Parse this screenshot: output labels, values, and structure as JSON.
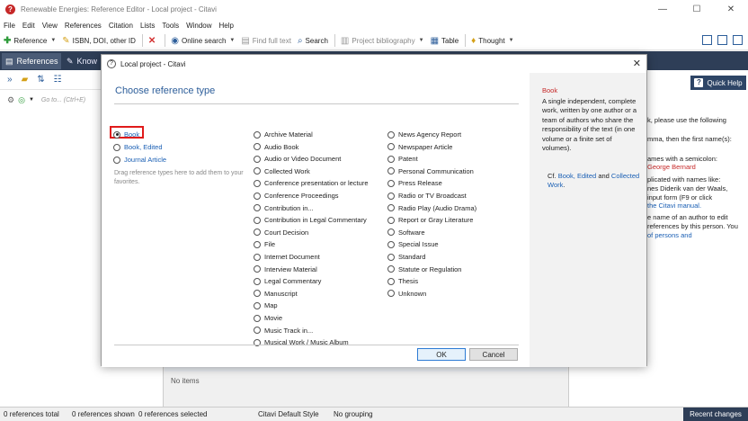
{
  "window": {
    "title": "Renewable Energies: Reference Editor - Local project - Citavi",
    "app_icon": "?",
    "controls": [
      "—",
      "☐",
      "✕"
    ]
  },
  "menu": [
    "File",
    "Edit",
    "View",
    "References",
    "Citation",
    "Lists",
    "Tools",
    "Window",
    "Help"
  ],
  "toolbar": {
    "reference": "Reference",
    "isbn": "ISBN, DOI, other ID",
    "online_search": "Online search",
    "find_full_text": "Find full text",
    "search": "Search",
    "project_bibliography": "Project bibliography",
    "table": "Table",
    "thought": "Thought"
  },
  "tabs": {
    "references": "References",
    "knowledge": "Know"
  },
  "left_panel": {
    "goto_placeholder": "Go to... (Ctrl+E)"
  },
  "right_panel": {
    "quick_help": "Quick Help",
    "lines": [
      {
        "text": "k, please use the following",
        "color": "normal"
      },
      {
        "text": "mma, then the first name(s):",
        "color": "normal"
      },
      {
        "text": "George Bernard",
        "color": "red"
      },
      {
        "text": "ames with a semicolon:",
        "color": "normal"
      },
      {
        "text": "plicated with names like:",
        "color": "normal"
      },
      {
        "text": "nes Diderik van der Waals,",
        "color": "normal"
      },
      {
        "text": "input form (F9 or click",
        "color": "normal"
      },
      {
        "text": "the Citavi manual.",
        "color": "blue"
      },
      {
        "text": "e name of an author to edit",
        "color": "normal"
      },
      {
        "text": "references by this person. You",
        "color": "normal"
      },
      {
        "text": "of persons and",
        "color": "blue"
      }
    ]
  },
  "middle": {
    "no_items": "No items"
  },
  "status": {
    "total": "0 references total",
    "shown": "0 references shown",
    "selected": "0 references selected",
    "style": "Citavi Default Style",
    "grouping": "No grouping",
    "recent": "Recent changes"
  },
  "dialog": {
    "title": "Local project - Citavi",
    "heading": "Choose reference type",
    "col1": [
      {
        "label": "Book",
        "selected": true,
        "color": "blue"
      },
      {
        "label": "Book, Edited",
        "selected": false,
        "color": "blue"
      },
      {
        "label": "Journal Article",
        "selected": false,
        "color": "blue"
      }
    ],
    "hint": "Drag reference types here to add them to your favorites.",
    "col2": [
      "Archive Material",
      "Audio Book",
      "Audio or Video Document",
      "Collected Work",
      "Conference presentation or lecture",
      "Conference Proceedings",
      "Contribution in...",
      "Contribution in Legal Commentary",
      "Court Decision",
      "File",
      "Internet Document",
      "Interview Material",
      "Legal Commentary",
      "Manuscript",
      "Map",
      "Movie",
      "Music Track in...",
      "Musical Work / Music Album"
    ],
    "col3": [
      "News Agency Report",
      "Newspaper Article",
      "Patent",
      "Personal Communication",
      "Press Release",
      "Radio or TV Broadcast",
      "Radio Play (Audio Drama)",
      "Report or Gray Literature",
      "Software",
      "Special Issue",
      "Standard",
      "Statute or Regulation",
      "Thesis",
      "Unknown"
    ],
    "ok": "OK",
    "cancel": "Cancel",
    "side": {
      "title": "Book",
      "description": "A single independent, complete work, written by one author or a team of authors who share the responsibility of the text (in one volume or a finite set of volumes).",
      "cf_prefix": "Cf.",
      "cf_link1": "Book, Edited",
      "cf_and": "and",
      "cf_link2": "Collected Work",
      "cf_suffix": "."
    }
  }
}
